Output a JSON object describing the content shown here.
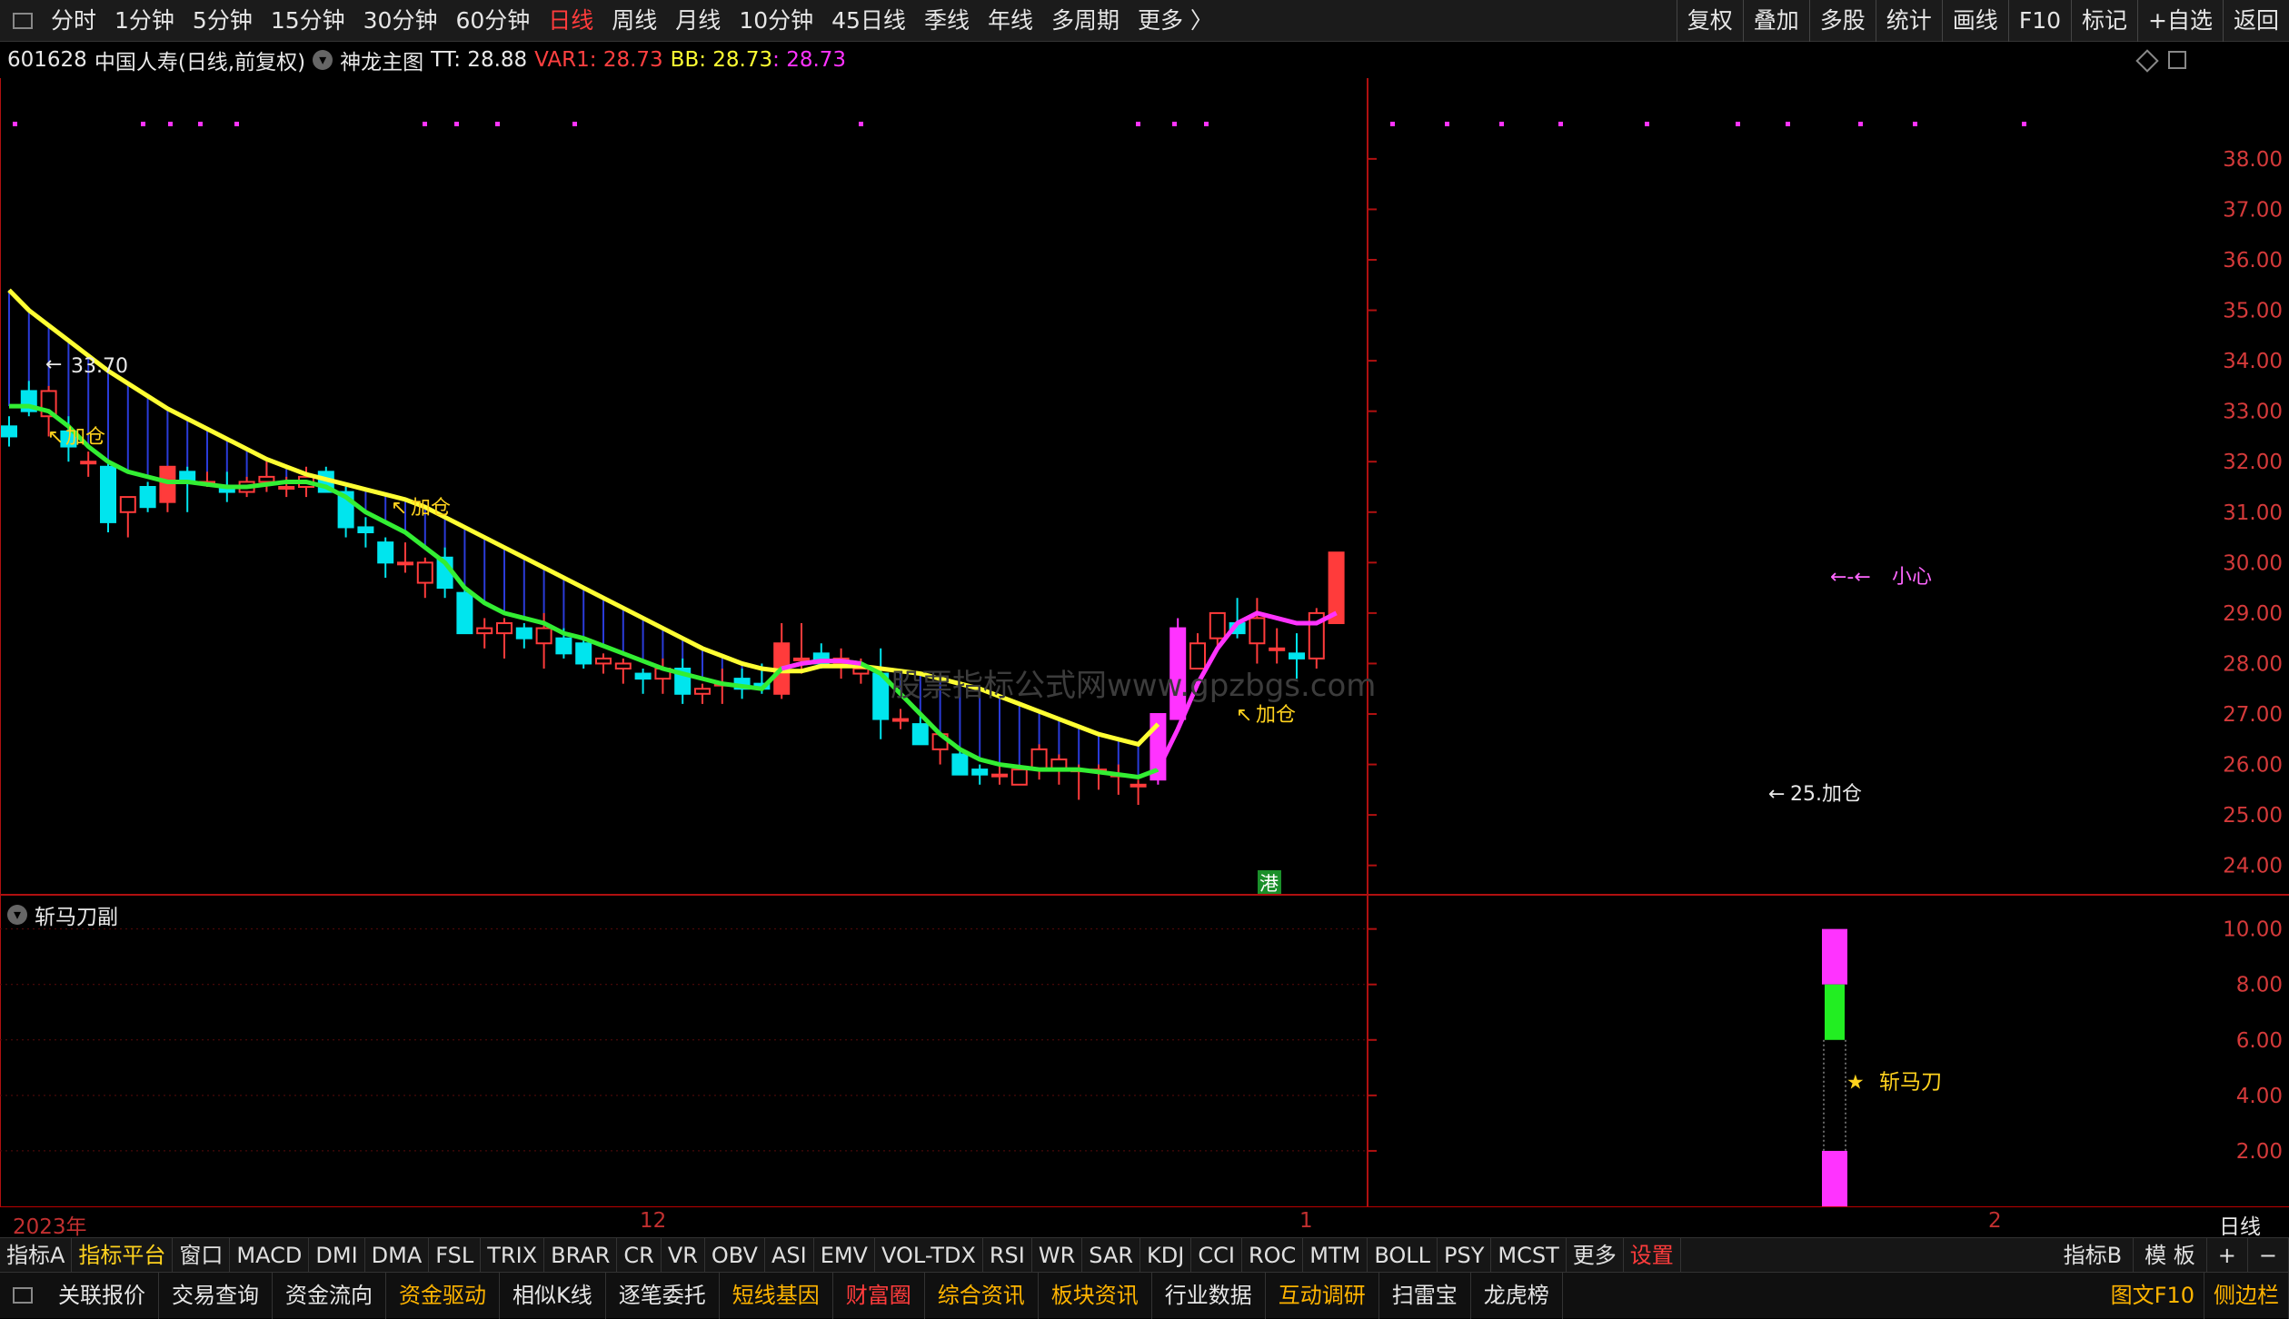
{
  "topbar": {
    "periods": [
      "分时",
      "1分钟",
      "5分钟",
      "15分钟",
      "30分钟",
      "60分钟",
      "日线",
      "周线",
      "月线",
      "10分钟",
      "45日线",
      "季线",
      "年线",
      "多周期",
      "更多 〉"
    ],
    "active_index": 6,
    "right_buttons": [
      "复权",
      "叠加",
      "多股",
      "统计",
      "画线",
      "F10",
      "标记",
      "+自选",
      "返回"
    ]
  },
  "info": {
    "code": "601628",
    "name": "中国人寿(日线,前复权)",
    "indicator": "神龙主图",
    "tt": "TT: 28.88",
    "var1": "VAR1: 28.73",
    "bb": "BB: 28.73",
    "bb2": ": 28.73"
  },
  "colors": {
    "up": "#ff3b3b",
    "down": "#00e5ee",
    "ma_yellow": "#ffff33",
    "ma_green": "#33ee33",
    "ma_magenta": "#ff33ff",
    "grid_red": "#b01010",
    "vline_blue": "#2a3bd8",
    "label_yellow": "#ffd21e"
  },
  "chart_data": {
    "type": "candlestick",
    "ylim": [
      23.4,
      39.6
    ],
    "yticks": [
      "38.00",
      "37.00",
      "36.00",
      "35.00",
      "34.00",
      "33.00",
      "32.00",
      "31.00",
      "30.00",
      "29.00",
      "28.00",
      "27.00",
      "26.00",
      "25.00",
      "24.00"
    ],
    "candles": [
      [
        32.7,
        32.9,
        32.3,
        32.5
      ],
      [
        33.4,
        33.6,
        32.9,
        33.0
      ],
      [
        32.9,
        33.5,
        32.5,
        33.4
      ],
      [
        32.6,
        32.9,
        32.0,
        32.3
      ],
      [
        32.0,
        32.2,
        31.7,
        32.0
      ],
      [
        31.9,
        32.0,
        30.6,
        30.8
      ],
      [
        31.0,
        31.2,
        30.5,
        31.3
      ],
      [
        31.5,
        31.6,
        31.0,
        31.1
      ],
      [
        31.2,
        31.9,
        31.0,
        31.9
      ],
      [
        31.8,
        31.9,
        31.0,
        31.6
      ],
      [
        31.6,
        31.8,
        31.5,
        31.6
      ],
      [
        31.5,
        31.8,
        31.2,
        31.4
      ],
      [
        31.4,
        31.7,
        31.3,
        31.6
      ],
      [
        31.6,
        32.0,
        31.4,
        31.7
      ],
      [
        31.5,
        31.7,
        31.3,
        31.5
      ],
      [
        31.5,
        31.9,
        31.3,
        31.7
      ],
      [
        31.8,
        31.9,
        31.4,
        31.4
      ],
      [
        31.4,
        31.5,
        30.5,
        30.7
      ],
      [
        30.7,
        30.9,
        30.3,
        30.6
      ],
      [
        30.4,
        30.5,
        29.7,
        30.0
      ],
      [
        30.0,
        30.4,
        29.8,
        30.0
      ],
      [
        29.6,
        30.1,
        29.3,
        30.0
      ],
      [
        30.1,
        30.3,
        29.3,
        29.5
      ],
      [
        29.4,
        29.5,
        28.6,
        28.6
      ],
      [
        28.6,
        28.9,
        28.3,
        28.7
      ],
      [
        28.6,
        28.9,
        28.1,
        28.8
      ],
      [
        28.7,
        28.8,
        28.3,
        28.5
      ],
      [
        28.4,
        29.0,
        27.9,
        28.7
      ],
      [
        28.5,
        28.7,
        28.1,
        28.2
      ],
      [
        28.4,
        28.5,
        27.9,
        28.0
      ],
      [
        28.0,
        28.2,
        27.8,
        28.1
      ],
      [
        27.9,
        28.1,
        27.6,
        28.0
      ],
      [
        27.8,
        27.9,
        27.4,
        27.7
      ],
      [
        27.7,
        28.1,
        27.4,
        27.9
      ],
      [
        27.9,
        28.1,
        27.2,
        27.4
      ],
      [
        27.4,
        27.6,
        27.2,
        27.5
      ],
      [
        27.6,
        27.9,
        27.2,
        27.6
      ],
      [
        27.7,
        27.9,
        27.3,
        27.5
      ],
      [
        27.6,
        28.0,
        27.4,
        27.5
      ],
      [
        27.4,
        28.8,
        27.3,
        28.4
      ],
      [
        28.1,
        28.8,
        27.8,
        28.1
      ],
      [
        28.2,
        28.4,
        27.9,
        28.0
      ],
      [
        28.0,
        28.3,
        27.7,
        28.1
      ],
      [
        27.8,
        28.1,
        27.6,
        27.9
      ],
      [
        27.8,
        28.3,
        26.5,
        26.9
      ],
      [
        26.9,
        27.1,
        26.7,
        26.9
      ],
      [
        26.8,
        27.0,
        26.4,
        26.4
      ],
      [
        26.3,
        26.6,
        26.0,
        26.6
      ],
      [
        26.2,
        26.3,
        25.8,
        25.8
      ],
      [
        25.9,
        26.0,
        25.6,
        25.8
      ],
      [
        25.8,
        26.0,
        25.6,
        25.8
      ],
      [
        25.6,
        26.0,
        25.6,
        25.9
      ],
      [
        25.9,
        26.4,
        25.7,
        26.3
      ],
      [
        25.9,
        26.2,
        25.6,
        26.1
      ],
      [
        25.9,
        26.0,
        25.3,
        25.9
      ],
      [
        25.9,
        26.0,
        25.5,
        25.9
      ],
      [
        25.8,
        26.0,
        25.4,
        25.8
      ],
      [
        25.6,
        25.7,
        25.2,
        25.6
      ],
      [
        25.7,
        27.0,
        25.6,
        27.0
      ],
      [
        26.9,
        28.9,
        26.9,
        28.7
      ],
      [
        27.9,
        28.6,
        27.9,
        28.4
      ],
      [
        28.5,
        29.0,
        28.3,
        29.0
      ],
      [
        28.8,
        29.3,
        28.5,
        28.6
      ],
      [
        28.4,
        29.3,
        28.0,
        28.9
      ],
      [
        28.3,
        28.7,
        28.0,
        28.3
      ],
      [
        28.2,
        28.6,
        27.7,
        28.1
      ],
      [
        28.1,
        29.1,
        27.9,
        29.0
      ],
      [
        28.8,
        30.2,
        28.8,
        30.2
      ]
    ],
    "ma_fast": [
      33.1,
      33.1,
      33.0,
      32.7,
      32.3,
      32.0,
      31.8,
      31.7,
      31.6,
      31.6,
      31.55,
      31.5,
      31.5,
      31.55,
      31.6,
      31.6,
      31.5,
      31.3,
      31.0,
      30.8,
      30.6,
      30.3,
      30.0,
      29.5,
      29.2,
      29.0,
      28.9,
      28.8,
      28.6,
      28.5,
      28.35,
      28.2,
      28.05,
      27.9,
      27.8,
      27.7,
      27.6,
      27.55,
      27.5,
      27.9,
      28.0,
      28.05,
      28.05,
      28.0,
      27.8,
      27.4,
      27.0,
      26.6,
      26.3,
      26.1,
      26.0,
      25.95,
      25.9,
      25.9,
      25.9,
      25.85,
      25.8,
      25.75,
      25.9,
      26.7,
      27.6,
      28.3,
      28.8,
      29.0,
      28.9,
      28.8,
      28.8,
      29.0
    ],
    "ma_fast_turn": 58,
    "ma_slow": [
      35.4,
      35.0,
      34.7,
      34.4,
      34.1,
      33.8,
      33.55,
      33.3,
      33.05,
      32.85,
      32.65,
      32.45,
      32.25,
      32.05,
      31.9,
      31.75,
      31.65,
      31.55,
      31.45,
      31.35,
      31.25,
      31.1,
      30.9,
      30.7,
      30.5,
      30.3,
      30.1,
      29.9,
      29.7,
      29.5,
      29.3,
      29.1,
      28.9,
      28.7,
      28.5,
      28.3,
      28.15,
      28.0,
      27.9,
      27.85,
      27.85,
      27.95,
      27.95,
      27.95,
      27.9,
      27.85,
      27.8,
      27.7,
      27.6,
      27.5,
      27.35,
      27.2,
      27.05,
      26.9,
      26.75,
      26.6,
      26.5,
      26.4,
      26.8
    ]
  },
  "annotations": {
    "price_mark": "33.70",
    "add1": "加仓",
    "add2": "加仓",
    "add3": "加仓",
    "add4": "25.加仓",
    "top_text": "小心",
    "hk_badge": "港",
    "watermark": "股票指标公式网www.gpzbgs.com"
  },
  "subchart": {
    "title": "斩马刀副",
    "ylim": [
      0,
      11.2
    ],
    "yticks": [
      "10.00",
      "8.00",
      "6.00",
      "4.00",
      "2.00"
    ],
    "label": "斩马刀",
    "bar_magenta_top": [
      8.0,
      10.0
    ],
    "bar_green": [
      6.0,
      8.0
    ],
    "bar_magenta_bottom": [
      0,
      2.0
    ]
  },
  "date_axis": {
    "labels": [
      "2023年",
      "12",
      "1",
      "2"
    ],
    "period": "日线"
  },
  "indicator_tabs": {
    "items": [
      "指标A",
      "指标平台",
      "窗口",
      "MACD",
      "DMI",
      "DMA",
      "FSL",
      "TRIX",
      "BRAR",
      "CR",
      "VR",
      "OBV",
      "ASI",
      "EMV",
      "VOL-TDX",
      "RSI",
      "WR",
      "SAR",
      "KDJ",
      "CCI",
      "ROC",
      "MTM",
      "BOLL",
      "PSY",
      "MCST",
      "更多",
      "设置"
    ],
    "right": [
      "指标B",
      "模 板",
      "+",
      "−"
    ]
  },
  "bottom_bar": {
    "items": [
      {
        "label": "关联报价",
        "color": "#e6e6e6"
      },
      {
        "label": "交易查询",
        "color": "#e6e6e6"
      },
      {
        "label": "资金流向",
        "color": "#e6e6e6"
      },
      {
        "label": "资金驱动",
        "color": "#ffb400"
      },
      {
        "label": "相似K线",
        "color": "#e6e6e6"
      },
      {
        "label": "逐笔委托",
        "color": "#e6e6e6"
      },
      {
        "label": "短线基因",
        "color": "#ffb400"
      },
      {
        "label": "财富圈",
        "color": "#ff3c3c"
      },
      {
        "label": "综合资讯",
        "color": "#ffb400"
      },
      {
        "label": "板块资讯",
        "color": "#ffb400"
      },
      {
        "label": "行业数据",
        "color": "#e6e6e6"
      },
      {
        "label": "互动调研",
        "color": "#ffb400"
      },
      {
        "label": "扫雷宝",
        "color": "#e6e6e6"
      },
      {
        "label": "龙虎榜",
        "color": "#e6e6e6"
      }
    ],
    "right": [
      {
        "label": "图文F10",
        "color": "#ffb400"
      },
      {
        "label": "侧边栏",
        "color": "#ffb400"
      }
    ]
  }
}
